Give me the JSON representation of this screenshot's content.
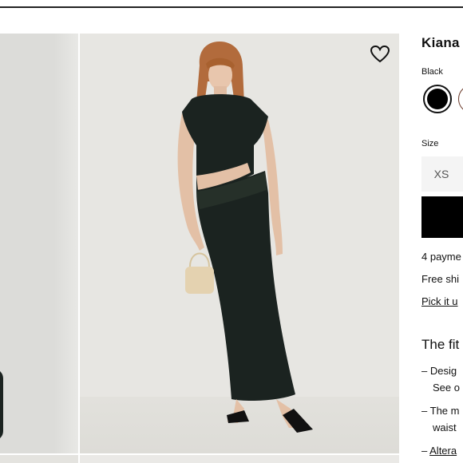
{
  "product": {
    "title": "Kiana",
    "color_label": "Black",
    "size_label": "Size",
    "size_option": "XS",
    "payments": "4 payme",
    "shipping": "Free shi",
    "pickup": "Pick it u",
    "fit_heading": "The fit",
    "fit_items": [
      {
        "dash": "–",
        "line1": "Desig",
        "line2": "See o"
      },
      {
        "dash": "–",
        "line1": "The m",
        "line2": "waist"
      },
      {
        "dash": "–",
        "line1": "Altera",
        "line2": ""
      }
    ]
  },
  "icons": {
    "wishlist": "heart-outline-icon"
  },
  "colors": {
    "swatch_black": "#000000",
    "swatch_brown": "#6a3a2a",
    "dress": "#1b2320",
    "background": "#e7e6e2"
  }
}
